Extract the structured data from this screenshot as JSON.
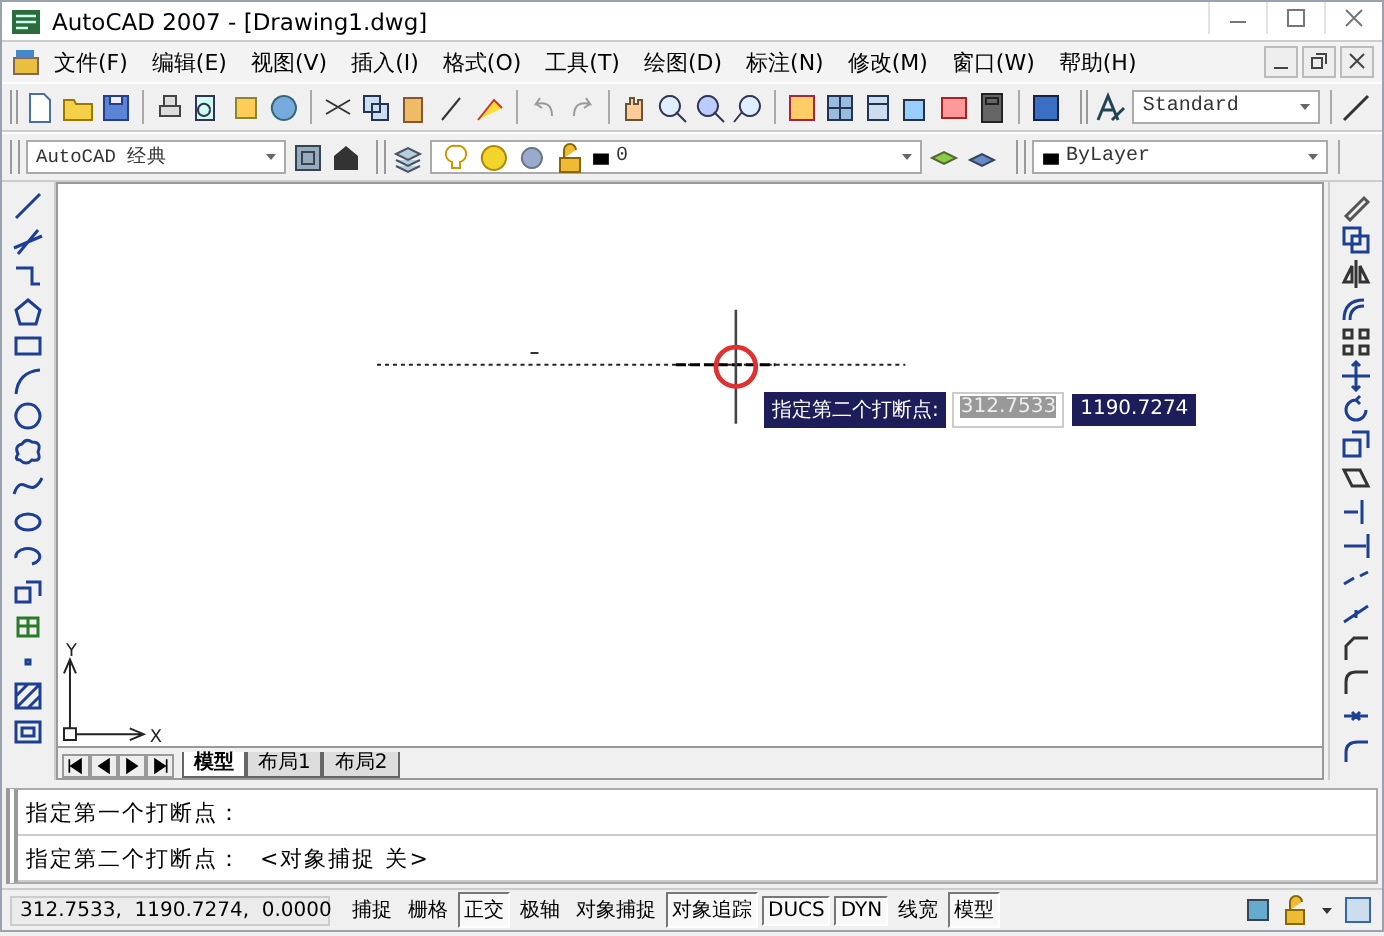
{
  "window": {
    "title": "AutoCAD 2007 - [Drawing1.dwg]"
  },
  "menu": [
    "文件(F)",
    "编辑(E)",
    "视图(V)",
    "插入(I)",
    "格式(O)",
    "工具(T)",
    "绘图(D)",
    "标注(N)",
    "修改(M)",
    "窗口(W)",
    "帮助(H)"
  ],
  "toolbars": {
    "workspace": "AutoCAD 经典",
    "layer": "0",
    "text_style": "Standard",
    "color_control": "ByLayer"
  },
  "canvas": {
    "ucs": {
      "y_label": "Y",
      "x_label": "X"
    },
    "dynamic_input": {
      "prompt": "指定第二个打断点:",
      "x_value": "312.7533",
      "y_value": "1190.7274"
    }
  },
  "layout_tabs": [
    {
      "label": "模型",
      "selected": true
    },
    {
      "label": "布局1",
      "selected": false
    },
    {
      "label": "布局2",
      "selected": false
    }
  ],
  "command_lines": [
    "指定第一个打断点：",
    "指定第二个打断点：  <对象捕捉 关>"
  ],
  "status_bar": {
    "coordinates": "312.7533,  1190.7274,  0.0000",
    "toggles": [
      {
        "label": "捕捉",
        "on": false
      },
      {
        "label": "栅格",
        "on": false
      },
      {
        "label": "正交",
        "on": true
      },
      {
        "label": "极轴",
        "on": false
      },
      {
        "label": "对象捕捉",
        "on": false
      },
      {
        "label": "对象追踪",
        "on": true
      },
      {
        "label": "DUCS",
        "on": true
      },
      {
        "label": "DYN",
        "on": true
      },
      {
        "label": "线宽",
        "on": false
      },
      {
        "label": "模型",
        "on": true
      }
    ]
  }
}
